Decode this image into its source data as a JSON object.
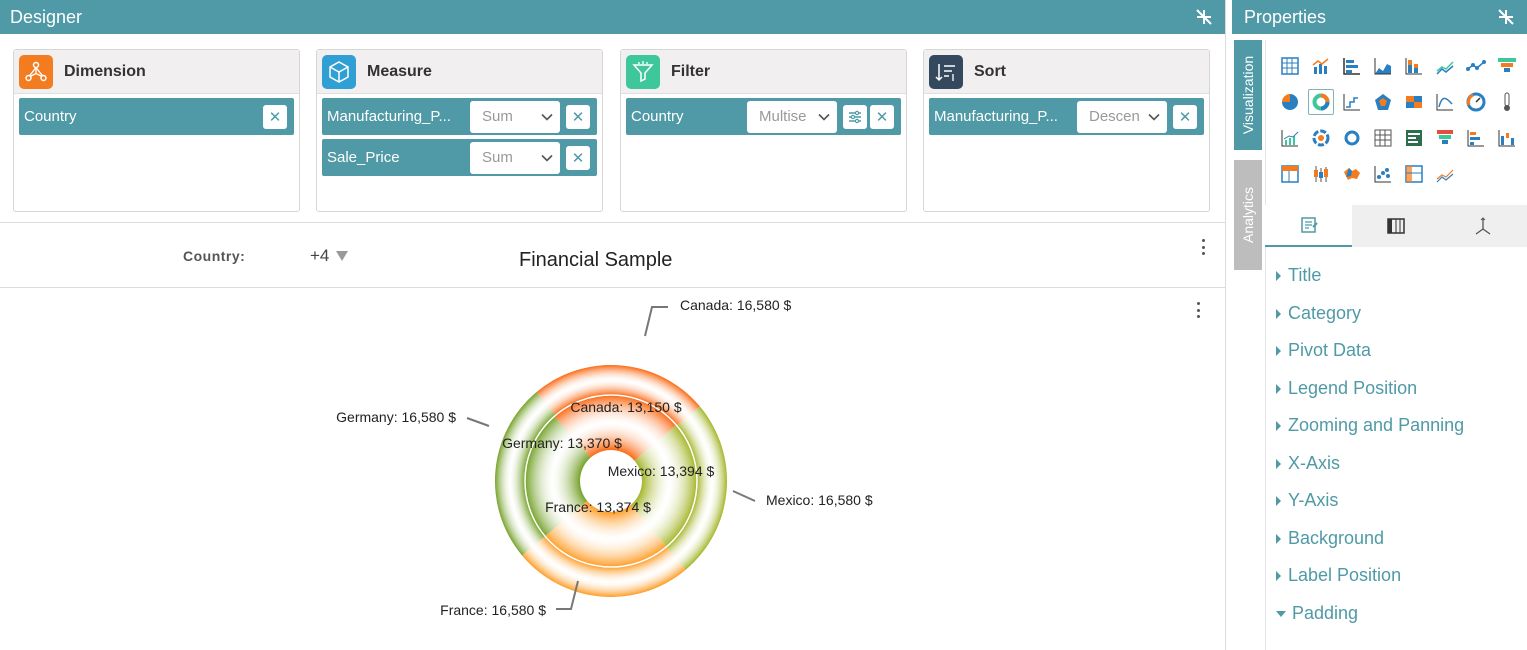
{
  "designer": {
    "title": "Designer"
  },
  "panels": {
    "dimension": {
      "title": "Dimension",
      "chips": [
        {
          "label": "Country"
        }
      ]
    },
    "measure": {
      "title": "Measure",
      "chips": [
        {
          "label": "Manufacturing_P...",
          "select": "Sum"
        },
        {
          "label": "Sale_Price",
          "select": "Sum"
        }
      ]
    },
    "filter": {
      "title": "Filter",
      "chips": [
        {
          "label": "Country",
          "select": "Multise"
        }
      ]
    },
    "sort": {
      "title": "Sort",
      "chips": [
        {
          "label": "Manufacturing_P...",
          "select": "Descen"
        }
      ]
    }
  },
  "filterbar": {
    "label": "Country:",
    "value": "+4",
    "title": "Financial Sample"
  },
  "chart_data": {
    "type": "pie",
    "subtype": "doughnut",
    "title": "",
    "series": [
      {
        "name": "",
        "ring": "outer",
        "values": [
          {
            "label": "Canada",
            "value": 16580,
            "text": "Canada: 16,580 $",
            "color": "#76a22b"
          },
          {
            "label": "Mexico",
            "value": 16580,
            "text": "Mexico: 16,580 $",
            "color": "#fa6a15"
          },
          {
            "label": "France",
            "value": 16580,
            "text": "France: 16,580 $",
            "color": "#a4b62a"
          },
          {
            "label": "Germany",
            "value": 16580,
            "text": "Germany: 16,580 $",
            "color": "#fd9d27"
          }
        ]
      },
      {
        "name": "",
        "ring": "inner",
        "values": [
          {
            "label": "Canada",
            "value": 13150,
            "text": "Canada: 13,150 $",
            "color": "#76a22b"
          },
          {
            "label": "Mexico",
            "value": 13394,
            "text": "Mexico: 13,394 $",
            "color": "#fa6a15"
          },
          {
            "label": "France",
            "value": 13374,
            "text": "France: 13,374 $",
            "color": "#a4b62a"
          },
          {
            "label": "Germany",
            "value": 13370,
            "text": "Germany: 13,370 $",
            "color": "#fd9d27"
          }
        ]
      }
    ]
  },
  "properties": {
    "title": "Properties",
    "vtabs": {
      "visualization": "Visualization",
      "analytics": "Analytics"
    },
    "items": [
      {
        "label": "Title",
        "expanded": false
      },
      {
        "label": "Category",
        "expanded": false
      },
      {
        "label": "Pivot Data",
        "expanded": false
      },
      {
        "label": "Legend Position",
        "expanded": false
      },
      {
        "label": "Zooming and Panning",
        "expanded": false
      },
      {
        "label": "X-Axis",
        "expanded": false
      },
      {
        "label": "Y-Axis",
        "expanded": false
      },
      {
        "label": "Background",
        "expanded": false
      },
      {
        "label": "Label Position",
        "expanded": false
      },
      {
        "label": "Padding",
        "expanded": true
      }
    ]
  },
  "colors": {
    "accent": "#4f9aa6",
    "dimension": "#f47c20",
    "measure": "#2f9fd4",
    "filter": "#3ec79b",
    "sort": "#34495e"
  }
}
